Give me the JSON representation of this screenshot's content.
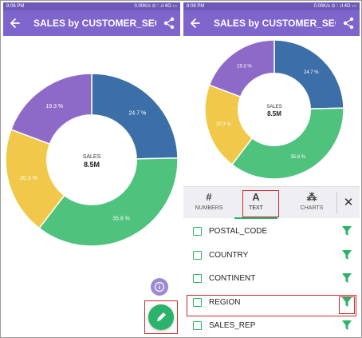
{
  "colors": {
    "status_bar": "#6e59b8",
    "app_bar": "#7e65cc",
    "accent_green": "#2bb36c",
    "highlight_red": "#d02b2b"
  },
  "left_screen": {
    "status_time": "8:06 PM",
    "status_network": "0.00K/s ⊙ ⫶ .ıl 4G ▭",
    "title": "SALES by CUSTOMER_SEG...",
    "icons": [
      "back-arrow-icon",
      "share-icon",
      "info-icon",
      "pencil-icon"
    ]
  },
  "right_screen": {
    "status_time": "8:08 PM",
    "status_network": "0.00K/s ⊙ ⫶ .ıl 4G ▭",
    "title": "SALES by CUSTOMER_SEG...",
    "icons": [
      "back-arrow-icon",
      "share-icon",
      "close-icon",
      "filter-icon"
    ],
    "tabs": [
      {
        "label": "NUMBERS",
        "icon": "#"
      },
      {
        "label": "TEXT",
        "icon": "A"
      },
      {
        "label": "CHARTS",
        "icon": "⁂"
      }
    ],
    "active_tab": "TEXT",
    "close_glyph": "✕",
    "fields": [
      "POSTAL_CODE",
      "COUNTRY",
      "CONTINENT",
      "REGION",
      "SALES_REP"
    ],
    "highlighted_field": "REGION"
  },
  "chart_data": {
    "type": "pie",
    "style": "donut",
    "center_label": "SALES",
    "center_value": "8.5M",
    "slices": [
      {
        "label": "24.7 %",
        "value": 24.7,
        "color": "#3c6ea8"
      },
      {
        "label": "35.8 %",
        "value": 35.8,
        "color": "#4fc27e"
      },
      {
        "label": "20.3 %",
        "value": 20.3,
        "color": "#f1c84a"
      },
      {
        "label": "19.3 %",
        "value": 19.3,
        "color": "#8d6ac8"
      }
    ]
  }
}
